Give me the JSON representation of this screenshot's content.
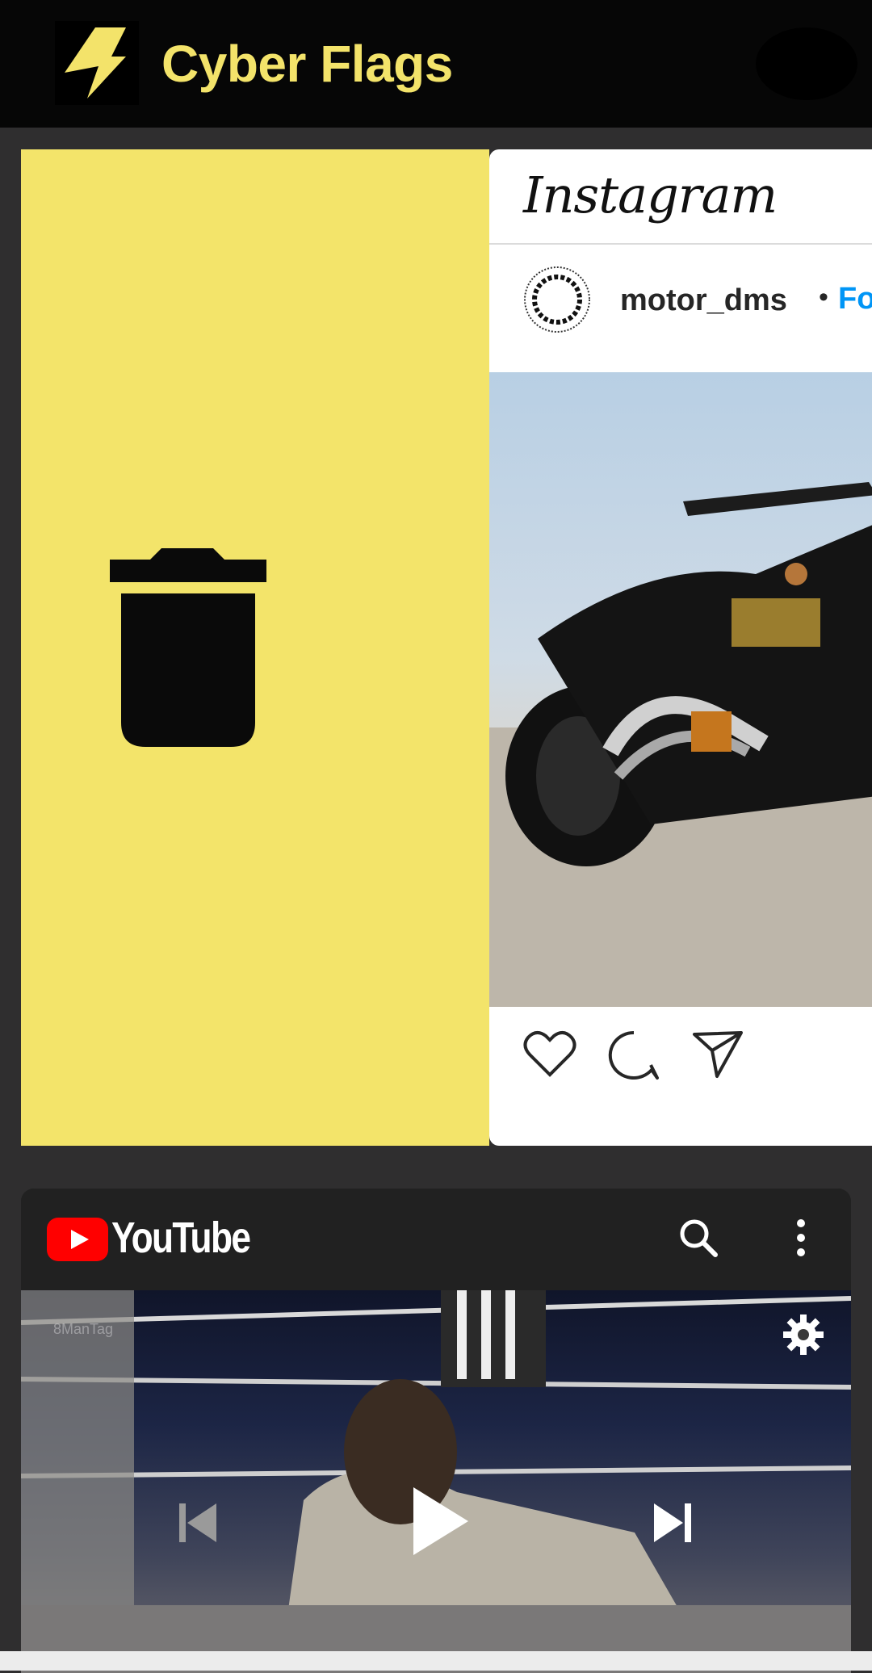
{
  "app": {
    "title": "Cyber Flags",
    "accent_color": "#f3e36a",
    "logo_icon": "lightning-bolt-icon",
    "avatar_icon": "profile-avatar"
  },
  "swipe": {
    "action_icon": "trash-icon",
    "action_background": "#f3e46a"
  },
  "instagram": {
    "brand": "Instagram",
    "username": "motor_dms",
    "separator": "•",
    "follow_label": "Foll",
    "follow_color": "#0095f6",
    "actions": [
      "heart-icon",
      "comment-icon",
      "share-icon"
    ]
  },
  "youtube": {
    "brand": "YouTube",
    "watermark": "8ManTag",
    "header_icons": [
      "search-icon",
      "more-vert-icon"
    ],
    "player_icons": [
      "settings-gear-icon",
      "skip-previous-icon",
      "play-icon",
      "skip-next-icon"
    ],
    "brand_color": "#ff0000"
  }
}
